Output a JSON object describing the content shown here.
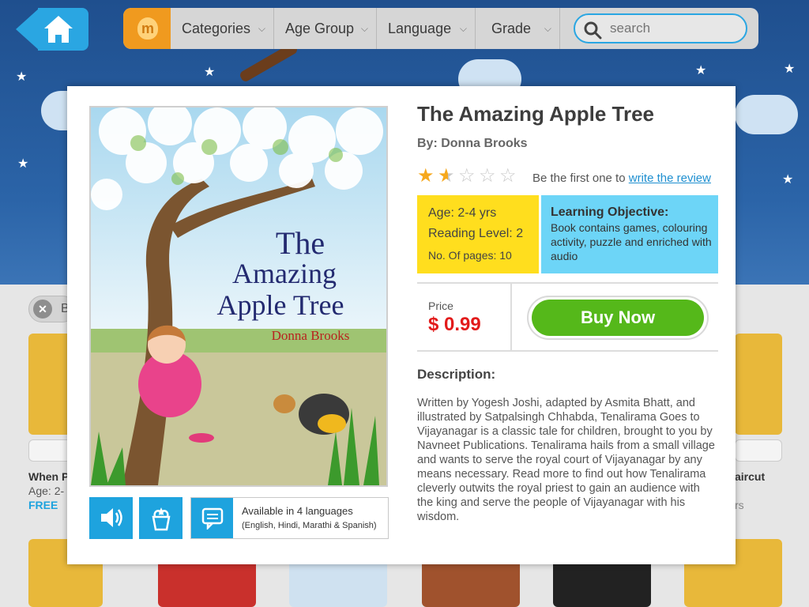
{
  "nav": {
    "logo_letter": "m",
    "items": [
      {
        "label": "Categories"
      },
      {
        "label": "Age Group"
      },
      {
        "label": "Language"
      },
      {
        "label": "Grade"
      }
    ],
    "search_placeholder": "search"
  },
  "background": {
    "filter_chip_text": "B",
    "books": [
      {
        "title": "When P",
        "age": "Age: 2-",
        "price": "FREE"
      },
      {
        "title": "aircut",
        "age": "rs"
      }
    ]
  },
  "book": {
    "title": "The Amazing Apple Tree",
    "author": "By: Donna Brooks",
    "cover": {
      "title_lines": [
        "The",
        "Amazing",
        "Apple Tree"
      ],
      "author": "Donna Brooks"
    },
    "rating": 1.5,
    "rating_max": 5,
    "review_prompt": "Be the first one to",
    "review_link": "write the review",
    "age": "Age: 2-4 yrs",
    "reading_level": "Reading Level: 2",
    "pages": "No. Of pages: 10",
    "learning_objective_label": "Learning Objective:",
    "learning_objective": "Book contains games, colouring activity, puzzle and enriched with audio",
    "price_label": "Price",
    "price": "$ 0.99",
    "buy_label": "Buy Now",
    "description_label": "Description:",
    "description": "Written by Yogesh Joshi, adapted by Asmita Bhatt, and illustrated by Satpalsingh Chhabda, Tenalirama Goes to Vijayanagar is a classic tale for children, brought to you by Navneet Publications. Tenalirama hails from a small village and wants to serve the royal court of Vijayanagar by any means necessary. Read more to find out how Tenalirama cleverly outwits the royal priest to gain an audience with the king and serve the people of Vijayanagar with his wisdom.",
    "languages_title": "Available in 4 languages",
    "languages_list": "(English, Hindi, Marathi & Spanish)"
  },
  "colors": {
    "accent_blue": "#1ea3de",
    "buy_green": "#55b81a",
    "price_red": "#e21b1b",
    "age_yellow": "#ffde1e",
    "objective_blue": "#6dd5f7"
  },
  "icons": [
    "home-icon",
    "search-icon",
    "chevron-down-icon",
    "speaker-icon",
    "activity-icon",
    "chat-icon",
    "star-icon",
    "close-icon"
  ]
}
